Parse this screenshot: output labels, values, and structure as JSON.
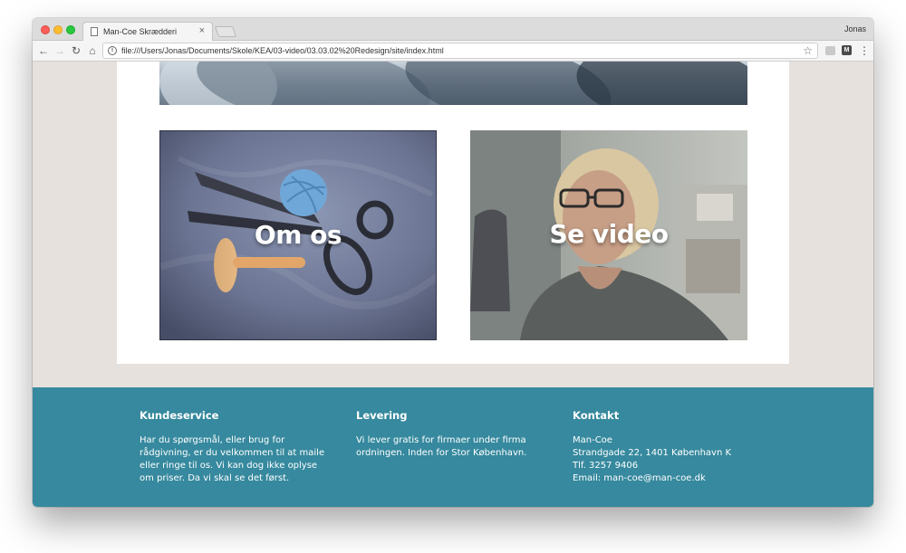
{
  "browser": {
    "tab_title": "Man-Coe Skrædderi",
    "tab_close": "×",
    "profile_name": "Jonas",
    "url": "file:///Users/Jonas/Documents/Skole/KEA/03-video/03.03.02%20Redesign/site/index.html",
    "nav": {
      "back": "←",
      "forward": "→",
      "reload": "↻",
      "home": "⌂"
    },
    "info_icon_glyph": "i",
    "star_glyph": "☆",
    "menu_glyph": "⋮",
    "ext2_glyph": "M"
  },
  "cards": {
    "about_label": "Om os",
    "video_label": "Se video"
  },
  "footer": {
    "customer_service": {
      "heading": "Kundeservice",
      "text": "Har du spørgsmål, eller brug for rådgivning, er du velkommen til at maile eller ringe til os. Vi kan dog ikke oplyse om priser. Da vi skal se det først."
    },
    "delivery": {
      "heading": "Levering",
      "text": "Vi lever gratis for firmaer under firma ordningen. Inden for Stor København."
    },
    "contact": {
      "heading": "Kontakt",
      "lines": [
        "Man-Coe",
        "Strandgade 22, 1401 København K",
        "Tlf. 3257 9406",
        "Email: man-coe@man-coe.dk"
      ]
    }
  },
  "colors": {
    "footer_bg": "#36899e",
    "page_bg": "#e6e1dc",
    "content_bg": "#ffffff"
  }
}
